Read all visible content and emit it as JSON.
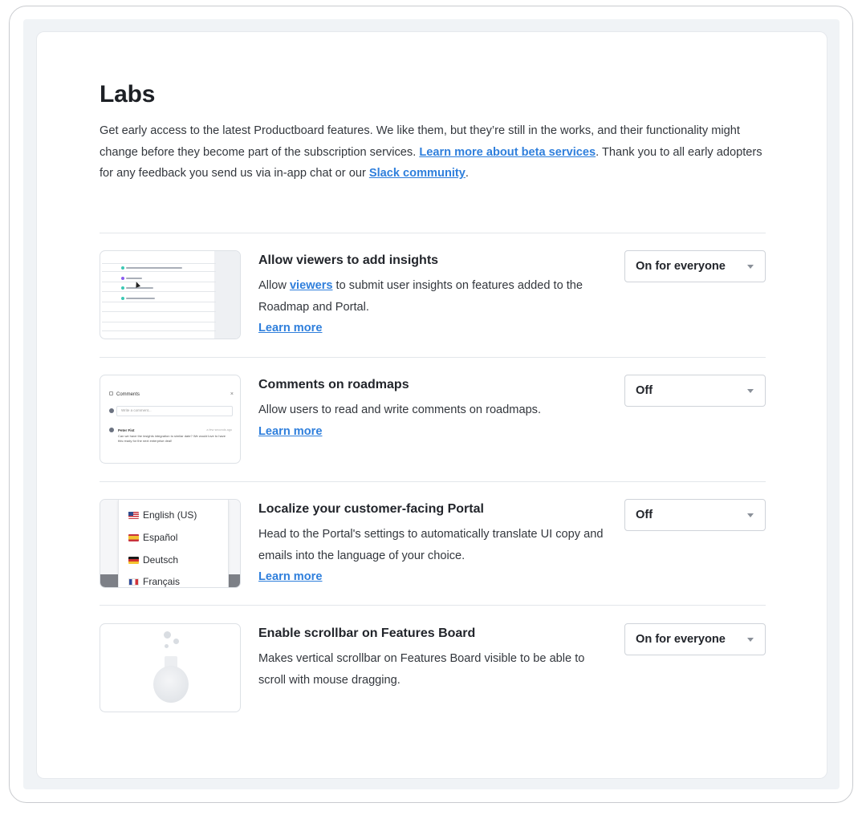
{
  "page": {
    "title": "Labs",
    "intro": {
      "part1": "Get early access to the latest Productboard features. We like them, but they’re still in the works, and their functionality might change before they become part of the subscription services. ",
      "link1": "Learn more about beta services",
      "part2": ". Thank you to all early adopters for any feedback you send us via in-app chat or our ",
      "link2": "Slack community",
      "part3": "."
    }
  },
  "features": [
    {
      "title": "Allow viewers to add insights",
      "desc_pre": "Allow ",
      "desc_link": "viewers",
      "desc_post": " to submit user insights on features added to the Roadmap and Portal.",
      "learn_more": "Learn more",
      "select_value": "On for everyone"
    },
    {
      "title": "Comments on roadmaps",
      "desc": "Allow users to read and write comments on roadmaps.",
      "learn_more": "Learn more",
      "select_value": "Off",
      "thumb": {
        "header": "Comments",
        "input_placeholder": "Write a comment...",
        "author": "Peter Fist",
        "time": "a few seconds ago",
        "comment": "Can we have the insights integration to similar date? We would love to have this ready for the next enterprise deal!"
      }
    },
    {
      "title": "Localize your customer-facing Portal",
      "desc": "Head to the Portal's settings to automatically translate UI copy and emails into the language of your choice.",
      "learn_more": "Learn more",
      "select_value": "Off",
      "languages": [
        "English (US)",
        "Español",
        "Deutsch",
        "Français"
      ]
    },
    {
      "title": "Enable scrollbar on Features Board",
      "desc": "Makes vertical scrollbar on Features Board visible to be able to scroll with mouse dragging.",
      "select_value": "On for everyone"
    }
  ],
  "icons": {
    "select_caret": "chevron-down-icon",
    "flask": "flask-icon"
  },
  "colors": {
    "link": "#2f7fdc",
    "background": "#f0f3f6"
  }
}
